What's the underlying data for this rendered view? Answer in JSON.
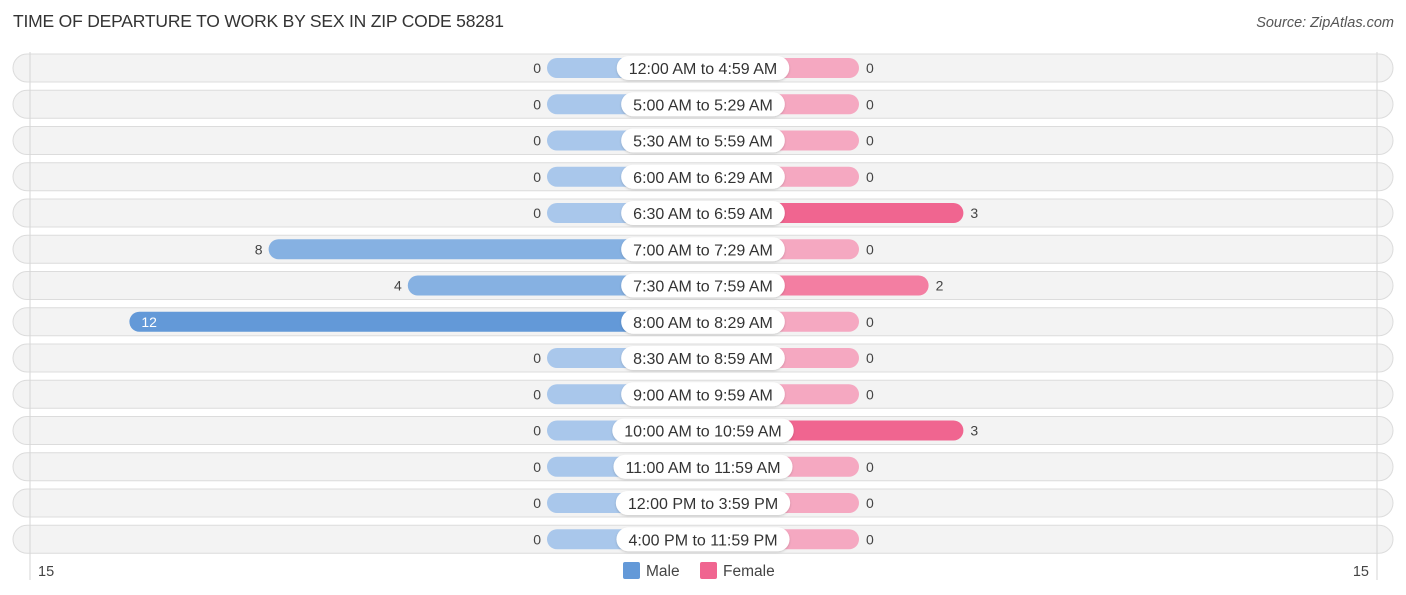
{
  "header": {
    "title": "TIME OF DEPARTURE TO WORK BY SEX IN ZIP CODE 58281",
    "source": "Source: ZipAtlas.com"
  },
  "colors": {
    "male_strong": "#6399d8",
    "male_light": "#a9c7eb",
    "female_strong": "#f06590",
    "female_light": "#f5a8c1",
    "row_background": "#f3f3f3"
  },
  "chart_data": {
    "type": "bar",
    "orientation": "horizontal-diverging",
    "title": "TIME OF DEPARTURE TO WORK BY SEX IN ZIP CODE 58281",
    "categories": [
      "12:00 AM to 4:59 AM",
      "5:00 AM to 5:29 AM",
      "5:30 AM to 5:59 AM",
      "6:00 AM to 6:29 AM",
      "6:30 AM to 6:59 AM",
      "7:00 AM to 7:29 AM",
      "7:30 AM to 7:59 AM",
      "8:00 AM to 8:29 AM",
      "8:30 AM to 8:59 AM",
      "9:00 AM to 9:59 AM",
      "10:00 AM to 10:59 AM",
      "11:00 AM to 11:59 AM",
      "12:00 PM to 3:59 PM",
      "4:00 PM to 11:59 PM"
    ],
    "series": [
      {
        "name": "Male",
        "values": [
          0,
          0,
          0,
          0,
          0,
          8,
          4,
          12,
          0,
          0,
          0,
          0,
          0,
          0
        ]
      },
      {
        "name": "Female",
        "values": [
          0,
          0,
          0,
          0,
          3,
          0,
          2,
          0,
          0,
          0,
          3,
          0,
          0,
          0
        ]
      }
    ],
    "axis": {
      "left_max_label": "15",
      "right_max_label": "15",
      "range": [
        0,
        15
      ]
    },
    "legend": {
      "position": "bottom-center",
      "items": [
        "Male",
        "Female"
      ]
    },
    "xlabel": "",
    "ylabel": ""
  }
}
